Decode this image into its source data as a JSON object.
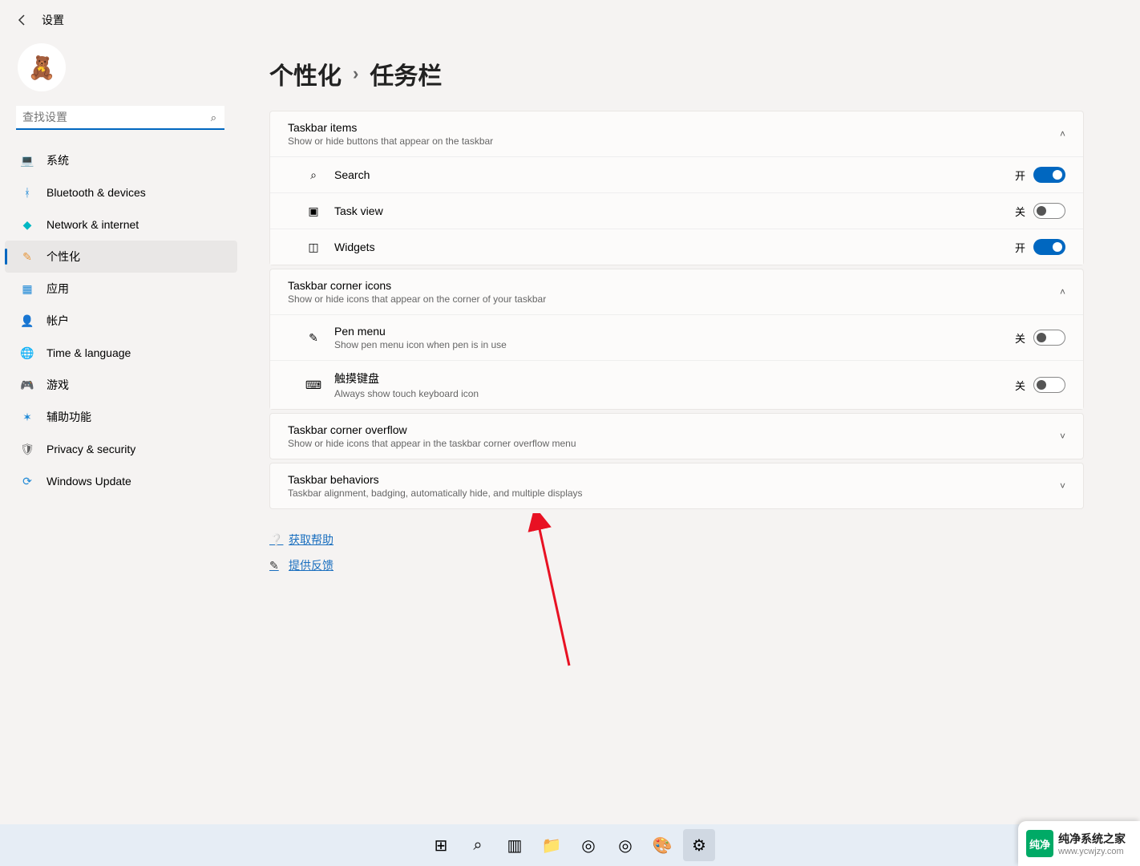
{
  "header": {
    "title": "设置"
  },
  "search": {
    "placeholder": "查找设置"
  },
  "nav": [
    {
      "icon": "💻",
      "label": "系统",
      "color": "c-blue"
    },
    {
      "icon": "ᚼ",
      "label": "Bluetooth & devices",
      "color": "c-blue"
    },
    {
      "icon": "◆",
      "label": "Network & internet",
      "color": "c-cyan"
    },
    {
      "icon": "✎",
      "label": "个性化",
      "color": "c-orange",
      "active": true
    },
    {
      "icon": "▦",
      "label": "应用",
      "color": "c-blue"
    },
    {
      "icon": "👤",
      "label": "帐户",
      "color": "c-green"
    },
    {
      "icon": "🌐",
      "label": "Time & language",
      "color": "c-teal"
    },
    {
      "icon": "🎮",
      "label": "游戏",
      "color": "c-gray"
    },
    {
      "icon": "✶",
      "label": "辅助功能",
      "color": "c-blue"
    },
    {
      "icon": "🛡",
      "label": "Privacy & security",
      "color": "c-gray"
    },
    {
      "icon": "⟳",
      "label": "Windows Update",
      "color": "c-blue"
    }
  ],
  "breadcrumb": {
    "parent": "个性化",
    "current": "任务栏"
  },
  "sections": [
    {
      "title": "Taskbar items",
      "desc": "Show or hide buttons that appear on the taskbar",
      "expanded": true,
      "rows": [
        {
          "icon": "⌕",
          "title": "Search",
          "state": "开",
          "on": true
        },
        {
          "icon": "▣",
          "title": "Task view",
          "state": "关",
          "on": false
        },
        {
          "icon": "◫",
          "title": "Widgets",
          "state": "开",
          "on": true
        }
      ]
    },
    {
      "title": "Taskbar corner icons",
      "desc": "Show or hide icons that appear on the corner of your taskbar",
      "expanded": true,
      "rows": [
        {
          "icon": "✎",
          "title": "Pen menu",
          "sub": "Show pen menu icon when pen is in use",
          "state": "关",
          "on": false
        },
        {
          "icon": "⌨",
          "title": "触摸键盘",
          "sub": "Always show touch keyboard icon",
          "state": "关",
          "on": false
        }
      ]
    },
    {
      "title": "Taskbar corner overflow",
      "desc": "Show or hide icons that appear in the taskbar corner overflow menu",
      "expanded": false
    },
    {
      "title": "Taskbar behaviors",
      "desc": "Taskbar alignment, badging, automatically hide, and multiple displays",
      "expanded": false
    }
  ],
  "links": {
    "help": "获取帮助",
    "feedback": "提供反馈"
  },
  "taskbar": [
    {
      "icon": "⊞",
      "name": "start"
    },
    {
      "icon": "⌕",
      "name": "search"
    },
    {
      "icon": "▥",
      "name": "taskview"
    },
    {
      "icon": "📁",
      "name": "explorer"
    },
    {
      "icon": "◎",
      "name": "app1"
    },
    {
      "icon": "◎",
      "name": "chrome"
    },
    {
      "icon": "🎨",
      "name": "paint"
    },
    {
      "icon": "⚙",
      "name": "settings",
      "active": true
    }
  ],
  "watermark": {
    "brand": "纯净系统之家",
    "url": "www.ycwjzy.com",
    "badge": "纯净"
  }
}
